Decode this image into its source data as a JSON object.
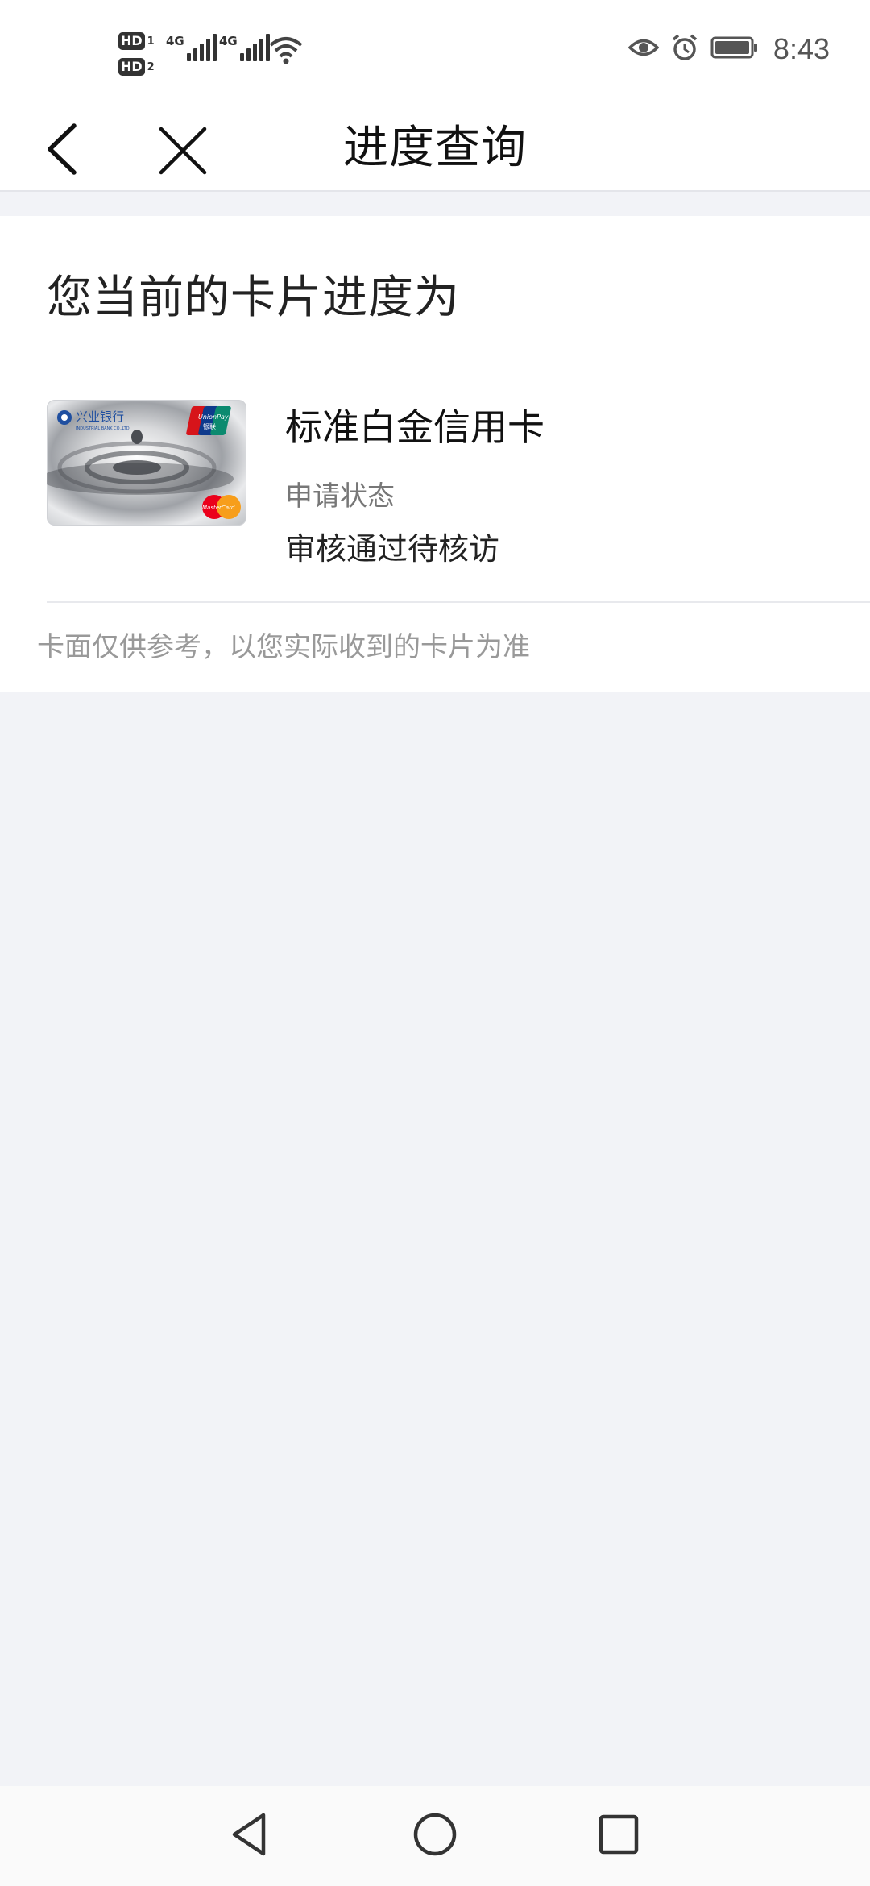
{
  "status_bar": {
    "sim1_badge": "HD",
    "sim1_slot": "1",
    "sim2_badge": "HD",
    "sim2_slot": "2",
    "sim1_network": "4G",
    "sim2_network": "4G",
    "time": "8:43",
    "icons": [
      "eye-icon",
      "alarm-icon",
      "battery-icon",
      "wifi-icon"
    ]
  },
  "nav": {
    "back_icon": "chevron-left-icon",
    "close_icon": "close-icon",
    "title": "进度查询"
  },
  "content": {
    "section_title": "您当前的卡片进度为",
    "card_name": "标准白金信用卡",
    "status_label": "申请状态",
    "status_value": "审核通过待核访",
    "note": "卡面仅供参考，以您实际收到的卡片为准",
    "card_image": {
      "bank_name": "兴业银行",
      "bank_name_en": "INDUSTRIAL BANK CO.,LTD.",
      "union_pay": "UnionPay",
      "union_pay_cn": "银联",
      "network": "MasterCard"
    }
  },
  "system_nav": {
    "icons": [
      "back-triangle-icon",
      "home-circle-icon",
      "recents-square-icon"
    ]
  },
  "colors": {
    "page_bg": "#f2f3f7",
    "surface": "#ffffff",
    "text_primary": "#111111",
    "text_secondary": "#777777",
    "text_hint": "#999999"
  }
}
